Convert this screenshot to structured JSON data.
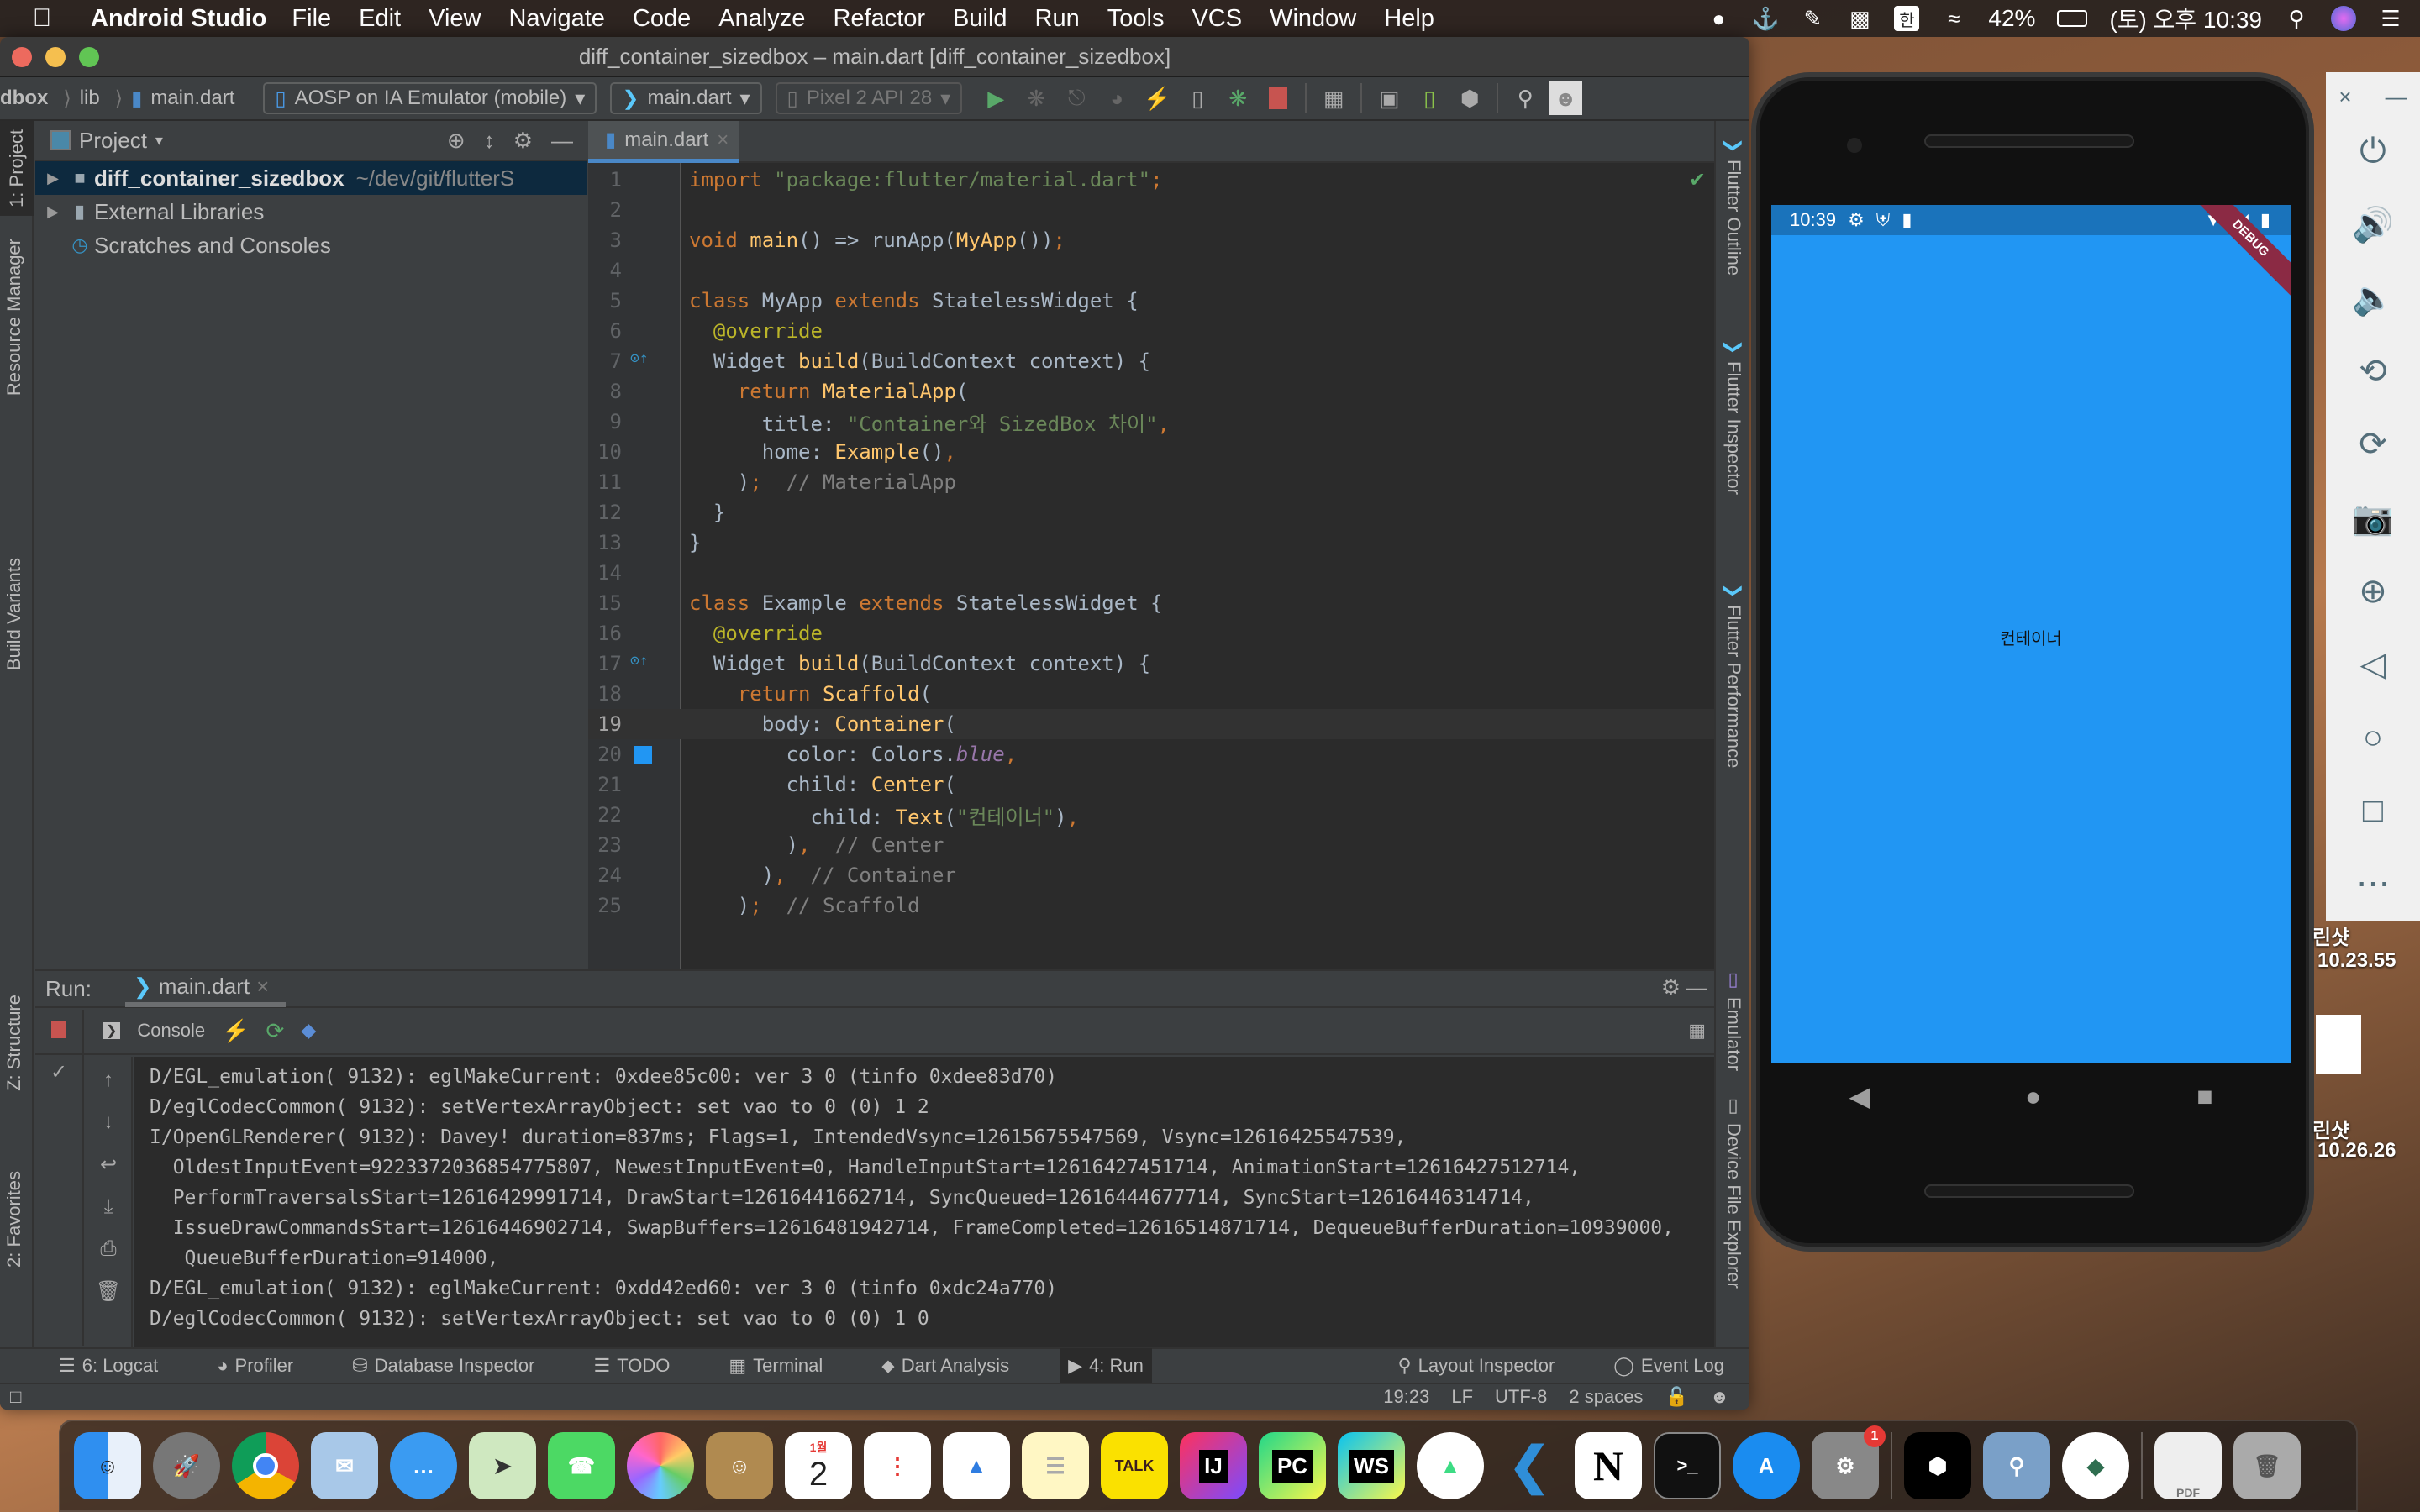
{
  "menubar": {
    "app_name": "Android Studio",
    "items": [
      "File",
      "Edit",
      "View",
      "Navigate",
      "Code",
      "Analyze",
      "Refactor",
      "Build",
      "Run",
      "Tools",
      "VCS",
      "Window",
      "Help"
    ],
    "battery": "42%",
    "clock": "(토) 오후 10:39",
    "input_method": "한"
  },
  "window": {
    "title": "diff_container_sizedbox – main.dart [diff_container_sizedbox]"
  },
  "navbar": {
    "breadcrumbs": [
      "dbox",
      "lib",
      "main.dart"
    ],
    "device_combo": "AOSP on IA Emulator (mobile)",
    "config_combo": "main.dart",
    "avd_combo": "Pixel 2 API 28"
  },
  "left_stripe": {
    "tabs": [
      "1: Project",
      "Resource Manager",
      "Build Variants",
      "Z: Structure",
      "2: Favorites"
    ]
  },
  "right_stripe": {
    "tabs": [
      "Flutter Outline",
      "Flutter Inspector",
      "Flutter Performance",
      "Emulator",
      "Device File Explorer"
    ]
  },
  "project": {
    "title": "Project",
    "tree": [
      {
        "name": "diff_container_sizedbox",
        "path": "~/dev/git/flutterS"
      },
      {
        "name": "External Libraries",
        "path": ""
      },
      {
        "name": "Scratches and Consoles",
        "path": ""
      }
    ]
  },
  "editor": {
    "tab": "main.dart",
    "current_line": 19,
    "lines": [
      "import \"package:flutter/material.dart\";",
      "",
      "void main() => runApp(MyApp());",
      "",
      "class MyApp extends StatelessWidget {",
      "  @override",
      "  Widget build(BuildContext context) {",
      "    return MaterialApp(",
      "      title: \"Container와 SizedBox 차이\",",
      "      home: Example(),",
      "    );  // MaterialApp",
      "  }",
      "}",
      "",
      "class Example extends StatelessWidget {",
      "  @override",
      "  Widget build(BuildContext context) {",
      "    return Scaffold(",
      "      body: Container(",
      "        color: Colors.blue,",
      "        child: Center(",
      "          child: Text(\"컨테이너\"),",
      "        ),  // Center",
      "      ),  // Container",
      "    );  // Scaffold"
    ]
  },
  "run_panel": {
    "label": "Run:",
    "tab": "main.dart",
    "console_label": "Console",
    "log": [
      "D/EGL_emulation( 9132): eglMakeCurrent: 0xdee85c00: ver 3 0 (tinfo 0xdee83d70)",
      "D/eglCodecCommon( 9132): setVertexArrayObject: set vao to 0 (0) 1 2",
      "I/OpenGLRenderer( 9132): Davey! duration=837ms; Flags=1, IntendedVsync=12615675547569, Vsync=12616425547539,",
      "  OldestInputEvent=9223372036854775807, NewestInputEvent=0, HandleInputStart=12616427451714, AnimationStart=12616427512714,",
      "  PerformTraversalsStart=12616429991714, DrawStart=12616441662714, SyncQueued=12616444677714, SyncStart=12616446314714,",
      "  IssueDrawCommandsStart=12616446902714, SwapBuffers=12616481942714, FrameCompleted=12616514871714, DequeueBufferDuration=10939000,",
      "   QueueBufferDuration=914000,",
      "D/EGL_emulation( 9132): eglMakeCurrent: 0xdd42ed60: ver 3 0 (tinfo 0xdc24a770)",
      "D/eglCodecCommon( 9132): setVertexArrayObject: set vao to 0 (0) 1 0"
    ]
  },
  "bottom_tools": {
    "left": [
      "6: Logcat",
      "Profiler",
      "Database Inspector",
      "TODO",
      "Terminal",
      "Dart Analysis",
      "4: Run"
    ],
    "right": [
      "Layout Inspector",
      "Event Log"
    ]
  },
  "status": {
    "position": "19:23",
    "line_sep": "LF",
    "encoding": "UTF-8",
    "indent": "2 spaces"
  },
  "emulator": {
    "time": "10:39",
    "debug_banner": "DEBUG",
    "center_text": "컨테이너",
    "screen_color": "#2196f3"
  },
  "desktop": {
    "labels": [
      "린샷",
      "10.23.55",
      "린샷",
      "10.26.26"
    ]
  },
  "dock": {
    "apps": [
      "Finder",
      "Launchpad",
      "Chrome",
      "Mail",
      "Messages",
      "Maps",
      "FaceTime",
      "Photos",
      "Contacts",
      "Calendar",
      "Reminders",
      "Keynote",
      "Notes",
      "KakaoTalk",
      "IntelliJ IDEA",
      "PyCharm",
      "WebStorm",
      "Android Studio",
      "VS Code",
      "Notion",
      "Terminal",
      "App Store",
      "System Preferences",
      "Unity",
      "Preview",
      "Android Studio Preview",
      "PDF",
      "Trash"
    ],
    "calendar_day": "2",
    "calendar_month": "1월",
    "sys_prefs_badge": "1"
  }
}
